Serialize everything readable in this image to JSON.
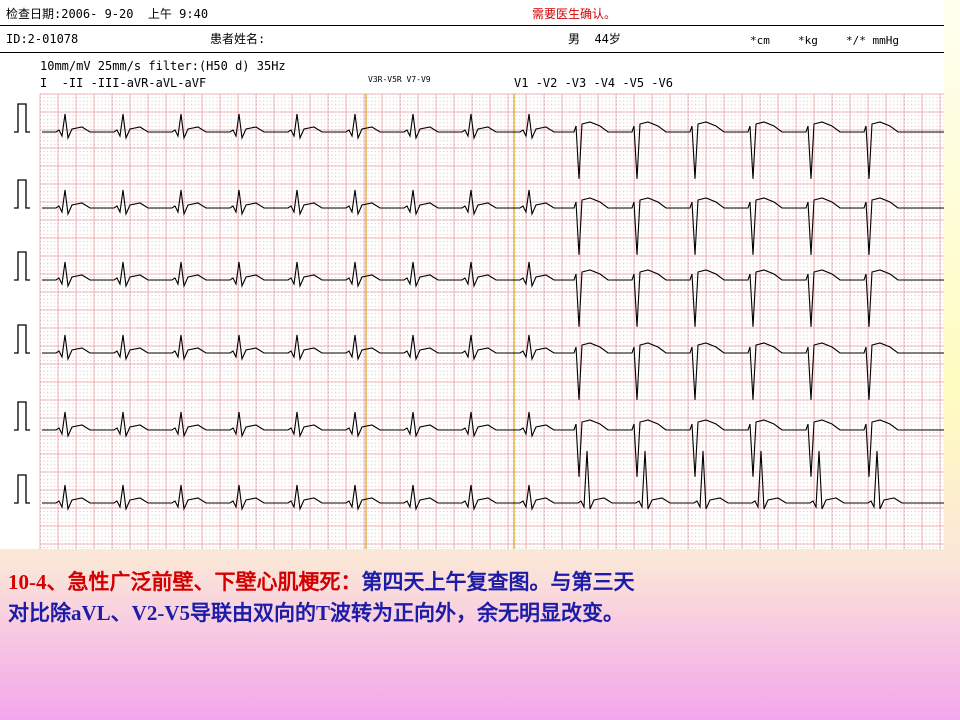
{
  "header": {
    "exam_date": "检查日期:2006- 9-20  上午 9:40",
    "confirm_notice": "需要医生确认。",
    "patient_id": "ID:2-01078",
    "patient_name_label": "患者姓名:",
    "sex_age": "男  44岁",
    "height": "*cm",
    "weight": "*kg",
    "bp": "*/* mmHg",
    "settings": "10mm/mV 25mm/s filter:(H50 d) 35Hz",
    "limb_leads": "I  -II -III-aVR-aVL-aVF",
    "right_leads": "V3R-V5R V7-V9",
    "chest_leads": "V1 -V2 -V3 -V4 -V5 -V6"
  },
  "colors": {
    "grid_line": "#e8a8a8",
    "grid_dot": "#d46a6a",
    "trace": "#000000",
    "marker": "#d4a017",
    "caption_red": "#d40000",
    "caption_blue": "#1c1ca8"
  },
  "caption": {
    "line1_red": "10-4、急性广泛前壁、下壁心肌梗死：",
    "line1_blue": "第四天上午复查图。与第三天",
    "line2_blue": "对比除aVL、V2-V5导联由双向的T波转为正向外，余无明显改变。"
  }
}
